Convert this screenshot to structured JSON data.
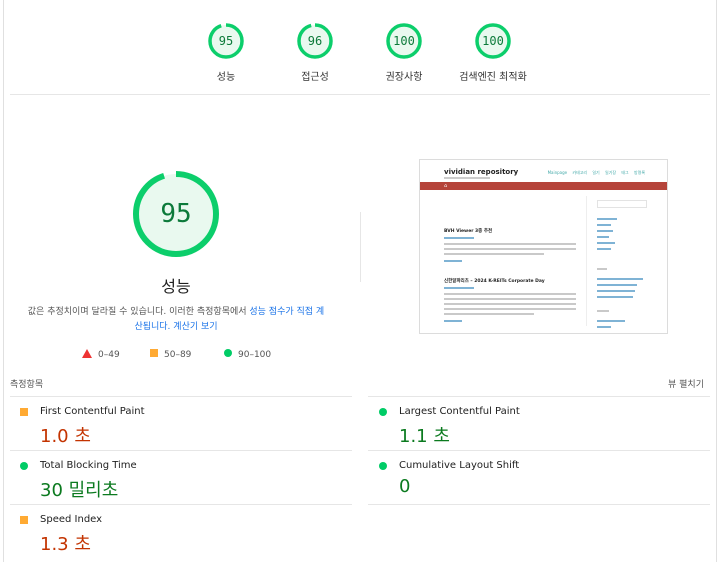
{
  "colors": {
    "pass": "#0cce6b",
    "pass_text": "#0c7a3a",
    "average": "#ffa400",
    "average_text": "#c33300",
    "fail": "#ff4e42",
    "good_value_text": "#0b7a1f"
  },
  "summary_gauges": [
    {
      "label": "성능",
      "score": "95",
      "ratio": 0.95
    },
    {
      "label": "접근성",
      "score": "96",
      "ratio": 0.96
    },
    {
      "label": "권장사항",
      "score": "100",
      "ratio": 1.0
    },
    {
      "label": "검색엔진 최적화",
      "score": "100",
      "ratio": 1.0
    }
  ],
  "performance": {
    "score": "95",
    "ratio": 0.95,
    "title": "성능",
    "note_prefix": "값은 추정치이며 달라질 수 있습니다. 이러한 측정항목에서 ",
    "note_link1": "성능 점수가 직접 계산됩니다.",
    "note_link2": "계산기 보기"
  },
  "legend": [
    {
      "shape": "triangle",
      "range": "0–49"
    },
    {
      "shape": "square",
      "range": "50–89"
    },
    {
      "shape": "circle",
      "range": "90–100"
    }
  ],
  "screenshot": {
    "site_title": "vividian repository",
    "menu": "Mainpage 카테고리 일기 일기장 태그 방명록",
    "post1_title": "BVH Viewer 3종 추천",
    "post2_title": "신한알파리츠 – 2024 K-REITs Corporate Day"
  },
  "metrics_section": {
    "label": "측정항목",
    "view_toggle": "뷰 펼치기"
  },
  "metrics": [
    {
      "name": "First Contentful Paint",
      "value": "1.0 초",
      "status": "average"
    },
    {
      "name": "Largest Contentful Paint",
      "value": "1.1 초",
      "status": "pass"
    },
    {
      "name": "Total Blocking Time",
      "value": "30 밀리초",
      "status": "pass"
    },
    {
      "name": "Cumulative Layout Shift",
      "value": "0",
      "status": "pass"
    },
    {
      "name": "Speed Index",
      "value": "1.3 초",
      "status": "average"
    }
  ]
}
